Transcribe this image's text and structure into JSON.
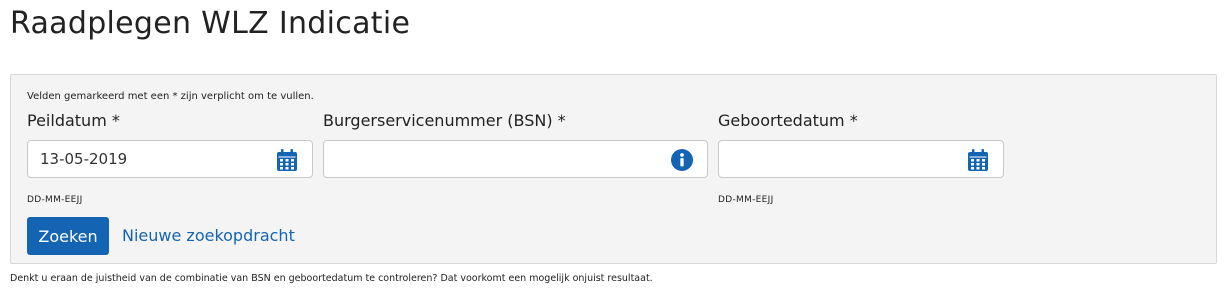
{
  "page": {
    "title": "Raadplegen WLZ Indicatie"
  },
  "form": {
    "required_note": "Velden gemarkeerd met een * zijn verplicht om te vullen.",
    "fields": {
      "peildatum": {
        "label": "Peildatum *",
        "value": "13-05-2019",
        "placeholder": "",
        "hint": "DD-MM-EEJJ",
        "icon": "calendar-icon"
      },
      "bsn": {
        "label": "Burgerservicenummer (BSN) *",
        "value": "",
        "placeholder": "",
        "icon": "info-icon"
      },
      "geboortedatum": {
        "label": "Geboortedatum *",
        "value": "",
        "placeholder": "",
        "hint": "DD-MM-EEJJ",
        "icon": "calendar-icon"
      }
    },
    "search_button": "Zoeken",
    "new_search_link": "Nieuwe zoekopdracht"
  },
  "footer_note": "Denkt u eraan de juistheid van de combinatie van BSN en geboortedatum te controleren? Dat voorkomt een mogelijk onjuist resultaat.",
  "colors": {
    "accent": "#1464b4",
    "panel_bg": "#f4f4f4"
  }
}
